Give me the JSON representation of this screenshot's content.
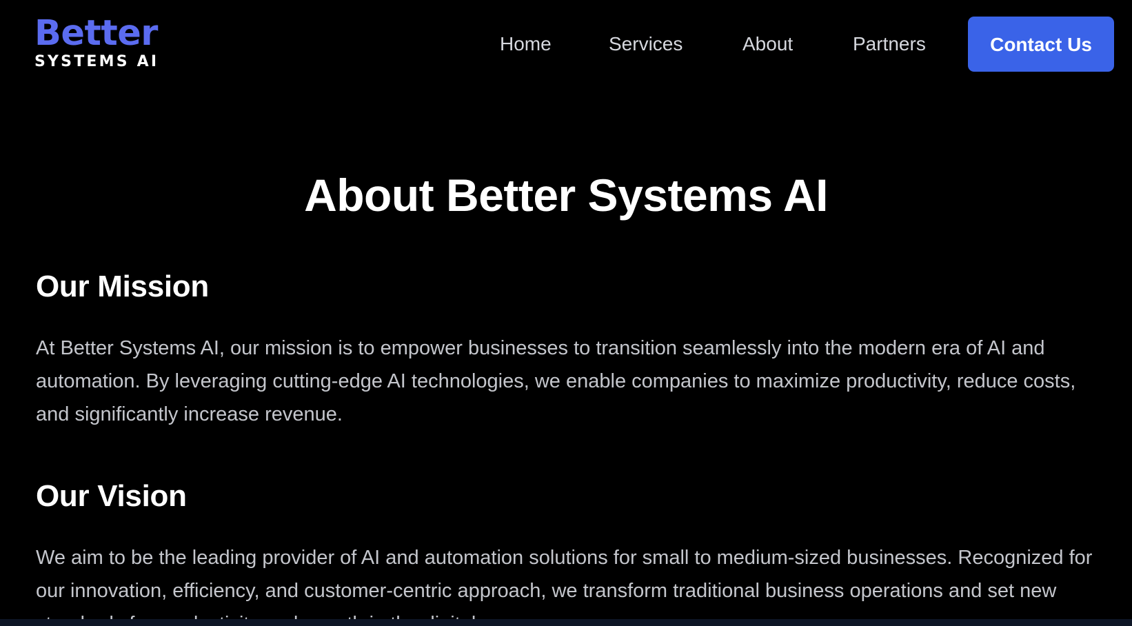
{
  "header": {
    "logo_top": "Better",
    "logo_bottom": "SYSTEMS AI",
    "nav": {
      "home": "Home",
      "services": "Services",
      "about": "About",
      "partners": "Partners"
    },
    "contact_button": "Contact Us"
  },
  "main": {
    "title": "About Better Systems AI",
    "mission": {
      "heading": "Our Mission",
      "text": "At Better Systems AI, our mission is to empower businesses to transition seamlessly into the modern era of AI and automation. By leveraging cutting-edge AI technologies, we enable companies to maximize productivity, reduce costs, and significantly increase revenue."
    },
    "vision": {
      "heading": "Our Vision",
      "text": "We aim to be the leading provider of AI and automation solutions for small to medium-sized businesses. Recognized for our innovation, efficiency, and customer-centric approach, we transform traditional business operations and set new standards for productivity and growth in the digital age."
    }
  },
  "colors": {
    "background": "#000000",
    "brand": "#5b6cf0",
    "button": "#3a63e8",
    "body_text": "#c4c6cc",
    "nav_text": "#d6d8de"
  }
}
